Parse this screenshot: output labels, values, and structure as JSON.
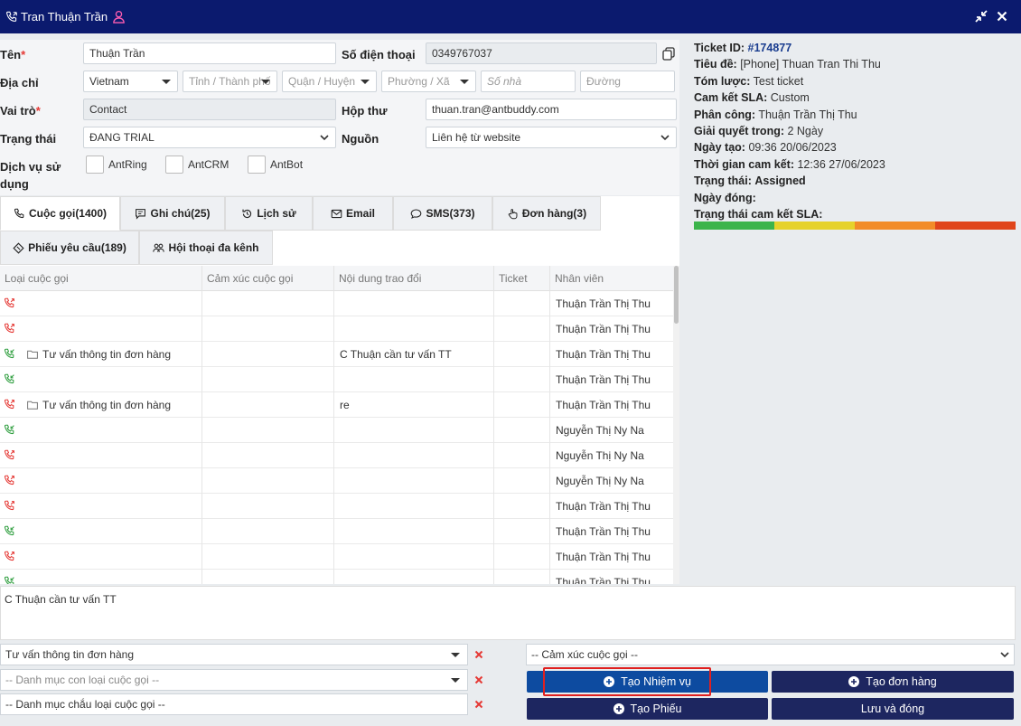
{
  "window": {
    "title": "Tran Thuận Trần",
    "icons": {
      "phone": "phone-icon",
      "user": "user-icon",
      "minimize": "compress-icon",
      "close": "close-icon"
    }
  },
  "form": {
    "name_label": "Tên",
    "name_value": "Thuận Trần",
    "phone_label": "Số điện thoại",
    "phone_value": "0349767037",
    "address_label": "Địa chỉ",
    "country_value": "Vietnam",
    "province_placeholder": "Tỉnh / Thành phố",
    "district_placeholder": "Quận / Huyện",
    "ward_placeholder": "Phường / Xã",
    "house_placeholder": "Số nhà",
    "street_placeholder": "Đường",
    "role_label": "Vai trò",
    "role_value": "Contact",
    "mailbox_label": "Hộp thư",
    "mailbox_value": "thuan.tran@antbuddy.com",
    "status_label": "Trạng thái",
    "status_value": "ĐANG TRIAL",
    "source_label": "Nguồn",
    "source_value": "Liên hệ từ website",
    "services_label_1": "Dịch vụ sử",
    "services_label_2": "dụng",
    "services": [
      "AntRing",
      "AntCRM",
      "AntBot"
    ]
  },
  "ticket": {
    "id_label": "Ticket ID:",
    "id_value": "#174877",
    "title_label": "Tiêu đề:",
    "title_value": "[Phone] Thuan Tran Thi Thu",
    "summary_label": "Tóm lược:",
    "summary_value": "Test ticket",
    "sla_label": "Cam kết SLA:",
    "sla_value": "Custom",
    "assign_label": "Phân công:",
    "assign_value": "Thuận Trần Thị Thu",
    "resolve_label": "Giải quyết trong:",
    "resolve_value": "2 Ngày",
    "created_label": "Ngày tạo:",
    "created_value": "09:36 20/06/2023",
    "commit_time_label": "Thời gian cam kết:",
    "commit_time_value": "12:36 27/06/2023",
    "state_label": "Trạng thái:",
    "state_value": "Assigned",
    "closed_label": "Ngày đóng:",
    "sla_state_label": "Trạng thái cam kết SLA:",
    "sla_colors": [
      "#3cb44b",
      "#e6d22b",
      "#f28c28",
      "#e0451b"
    ]
  },
  "tabs": {
    "calls": "Cuộc gọi(1400)",
    "notes": "Ghi chú(25)",
    "history": "Lịch sử",
    "email": "Email",
    "sms": "SMS(373)",
    "orders": "Đơn hàng(3)",
    "requests": "Phiếu yêu cầu(189)",
    "omni": "Hội thoại đa kênh"
  },
  "table": {
    "headers": [
      "Loại cuộc gọi",
      "Cảm xúc cuộc gọi",
      "Nội dung trao đổi",
      "Ticket",
      "Nhân viên"
    ],
    "rows": [
      {
        "dir": "out",
        "color": "#e53935",
        "type": "",
        "emotion": "",
        "content": "",
        "ticket": "",
        "agent": "Thuận Trần Thị Thu"
      },
      {
        "dir": "out",
        "color": "#e53935",
        "type": "",
        "emotion": "",
        "content": "",
        "ticket": "",
        "agent": "Thuận Trần Thị Thu"
      },
      {
        "dir": "in",
        "color": "#2e9e3e",
        "type": "Tư vấn thông tin đơn hàng",
        "emotion": "",
        "content": "C Thuận cần tư vấn TT",
        "ticket": "",
        "agent": "Thuận Trần Thị Thu"
      },
      {
        "dir": "in",
        "color": "#2e9e3e",
        "type": "",
        "emotion": "",
        "content": "",
        "ticket": "",
        "agent": "Thuận Trần Thị Thu"
      },
      {
        "dir": "out",
        "color": "#e53935",
        "type": "Tư vấn thông tin đơn hàng",
        "emotion": "",
        "content": "re",
        "ticket": "",
        "agent": "Thuận Trần Thị Thu"
      },
      {
        "dir": "in",
        "color": "#2e9e3e",
        "type": "",
        "emotion": "",
        "content": "",
        "ticket": "",
        "agent": "Nguyễn Thị Ny Na"
      },
      {
        "dir": "out",
        "color": "#e53935",
        "type": "",
        "emotion": "",
        "content": "",
        "ticket": "",
        "agent": "Nguyễn Thị Ny Na"
      },
      {
        "dir": "out",
        "color": "#e53935",
        "type": "",
        "emotion": "",
        "content": "",
        "ticket": "",
        "agent": "Nguyễn Thị Ny Na"
      },
      {
        "dir": "out",
        "color": "#e53935",
        "type": "",
        "emotion": "",
        "content": "",
        "ticket": "",
        "agent": "Thuận Trần Thị Thu"
      },
      {
        "dir": "in",
        "color": "#2e9e3e",
        "type": "",
        "emotion": "",
        "content": "",
        "ticket": "",
        "agent": "Thuận Trần Thị Thu"
      },
      {
        "dir": "out",
        "color": "#e53935",
        "type": "",
        "emotion": "",
        "content": "",
        "ticket": "",
        "agent": "Thuận Trần Thị Thu"
      },
      {
        "dir": "in",
        "color": "#2e9e3e",
        "type": "",
        "emotion": "",
        "content": "",
        "ticket": "",
        "agent": "Thuận Trần Thị Thu"
      }
    ]
  },
  "bottom": {
    "notes_value": "C Thuận cần tư vấn TT",
    "call_category_value": "Tư vấn thông tin đơn hàng",
    "call_subcategory_placeholder": "-- Danh mục con loại cuộc gọi --",
    "call_grandchild_placeholder": "-- Danh mục chắu loại cuộc gọi --",
    "emotion_placeholder": "-- Cảm xúc cuộc gọi --",
    "create_task_label": "Tạo Nhiệm vụ",
    "create_order_label": "Tạo đơn hàng",
    "create_ticket_label": "Tạo Phiếu",
    "save_close_label": "Lưu và đóng"
  }
}
